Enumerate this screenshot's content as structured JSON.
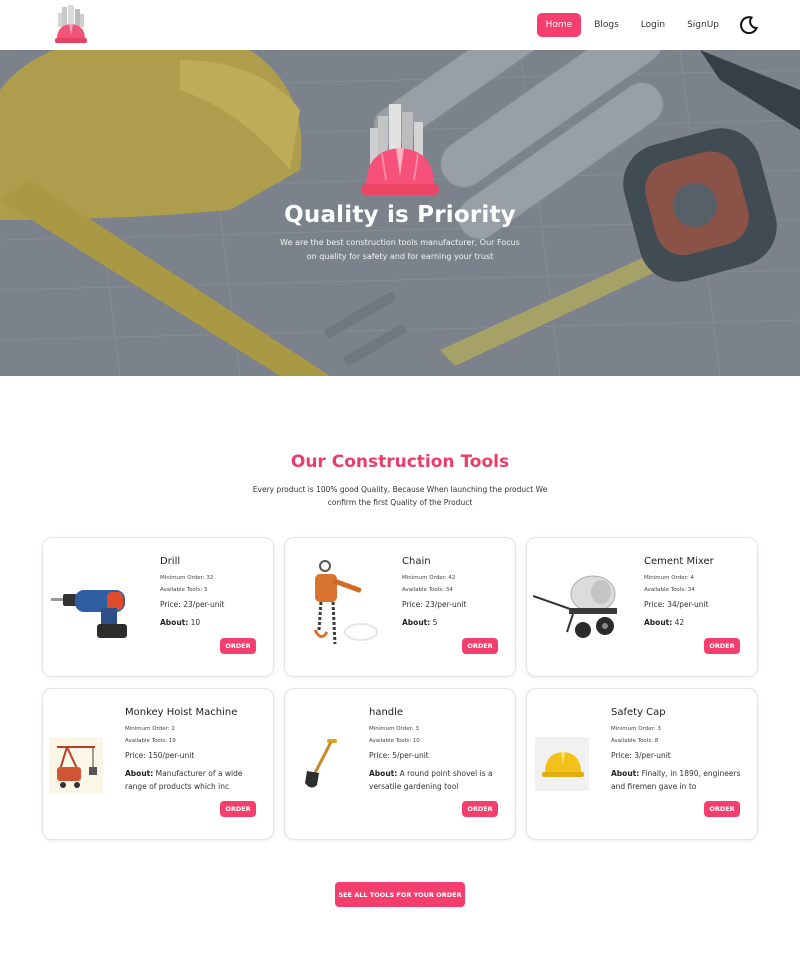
{
  "nav": {
    "items": [
      "Home",
      "Blogs",
      "Login",
      "SignUp"
    ],
    "active": "Home"
  },
  "hero": {
    "title": "Quality is Priority",
    "subtitle": "We are the best construction tools manufacturer, Our Focus on quality for safety and for earning your trust"
  },
  "tools_section": {
    "title": "Our Construction Tools",
    "subtitle": "Every product is 100% good Quality, Because When launching the product We confirm the first Quality of the Product"
  },
  "tools": [
    {
      "name": "Drill",
      "min_order": "Minimum Order: 32",
      "available": "Available Tools: 3",
      "price": "Price: 23/per-unit",
      "about_label": "About:",
      "about": " 10",
      "order": "ORDER",
      "icon": "drill-icon"
    },
    {
      "name": "Chain",
      "min_order": "Minimum Order: 42",
      "available": "Available Tools: 34",
      "price": "Price: 23/per-unit",
      "about_label": "About:",
      "about": " 5",
      "order": "ORDER",
      "icon": "chain-hoist-icon"
    },
    {
      "name": "Cement Mixer",
      "min_order": "Minimum Order: 4",
      "available": "Available Tools: 34",
      "price": "Price: 34/per-unit",
      "about_label": "About:",
      "about": " 42",
      "order": "ORDER",
      "icon": "cement-mixer-icon"
    },
    {
      "name": "Monkey Hoist Machine",
      "min_order": "Minimum Order: 2",
      "available": "Available Tools: 19",
      "price": "Price: 150/per-unit",
      "about_label": "About:",
      "about": " Manufacturer of a wide range of products which inc",
      "order": "ORDER",
      "icon": "hoist-machine-icon"
    },
    {
      "name": "handle",
      "min_order": "Minimum Order: 3",
      "available": "Available Tools: 10",
      "price": "Price: 5/per-unit",
      "about_label": "About:",
      "about": " A round point shovel is a versatile gardening tool",
      "order": "ORDER",
      "icon": "shovel-icon"
    },
    {
      "name": "Safety Cap",
      "min_order": "Minimum Order: 3",
      "available": "Available Tools: 8",
      "price": "Price: 3/per-unit",
      "about_label": "About:",
      "about": " Finally, in 1890, engineers and firemen gave in to",
      "order": "ORDER",
      "icon": "safety-cap-icon"
    }
  ],
  "see_all": "SEE ALL TOOLS FOR YOUR ORDER",
  "colors": {
    "accent": "#f43f6e",
    "title": "#ec3c6a"
  }
}
